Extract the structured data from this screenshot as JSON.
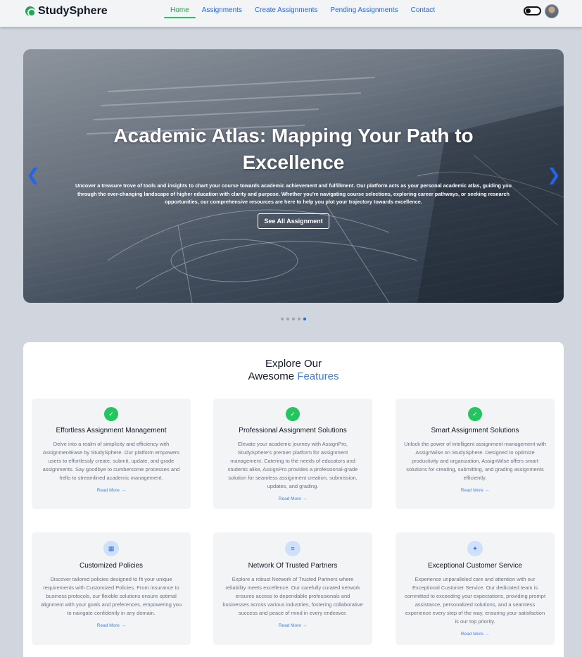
{
  "navbar": {
    "brand": "StudySphere",
    "links": [
      "Home",
      "Assignments",
      "Create Assignments",
      "Pending Assignments",
      "Contact"
    ],
    "active_index": 0
  },
  "hero": {
    "title": "Academic Atlas: Mapping Your Path to Excellence",
    "text": "Uncover a treasure trove of tools and insights to chart your course towards academic achievement and fulfillment. Our platform acts as your personal academic atlas, guiding you through the ever-changing landscape of higher education with clarity and purpose. Whether you're navigating course selections, exploring career pathways, or seeking research opportunities, our comprehensive resources are here to help you plot your trajectory towards excellence.",
    "button": "See All Assignment",
    "slide_count": 5,
    "active_slide": 5
  },
  "features": {
    "heading_line1": "Explore Our",
    "heading_line2": "Awesome",
    "heading_accent": "Features",
    "read_more": "Read More",
    "cards": [
      {
        "icon": "check-badge-icon",
        "title": "Effortless Assignment Management",
        "desc": "Delve into a realm of simplicity and efficiency with AssignmentEase by StudySphere. Our platform empowers users to effortlessly create, submit, update, and grade assignments. Say goodbye to cumbersome processes and hello to streamlined academic management."
      },
      {
        "icon": "check-badge-icon",
        "title": "Professional Assignment Solutions",
        "desc": "Elevate your academic journey with AssignPro, StudySphere's premier platform for assignment management. Catering to the needs of educators and students alike, AssignPro provides a professional-grade solution for seamless assignment creation, submission, updates, and grading."
      },
      {
        "icon": "check-badge-icon",
        "title": "Smart Assignment Solutions",
        "desc": "Unlock the power of intelligent assignment management with AssignWise on StudySphere. Designed to optimize productivity and organization, AssignWise offers smart solutions for creating, submitting, and grading assignments efficiently."
      },
      {
        "icon": "clipboard-icon",
        "title": "Customized Policies",
        "desc": "Discover tailored policies designed to fit your unique requirements with Customized Policies. From insurance to business protocols, our flexible solutions ensure optimal alignment with your goals and preferences, empowering you to navigate confidently in any domain."
      },
      {
        "icon": "sliders-icon",
        "title": "Network Of Trusted Partners",
        "desc": "Explore a robust Network of Trusted Partners where reliability meets excellence. Our carefully curated network ensures access to dependable professionals and businesses across various industries, fostering collaborative success and peace of mind in every endeavor."
      },
      {
        "icon": "sparkle-icon",
        "title": "Exceptional Customer Service",
        "desc": "Experience unparalleled care and attention with our Exceptional Customer Service. Our dedicated team is committed to exceeding your expectations, providing prompt assistance, personalized solutions, and a seamless experience every step of the way, ensuring your satisfaction is our top priority."
      }
    ]
  },
  "colors": {
    "accent_blue": "#2563eb",
    "active_green": "#16a34a",
    "page_bg": "#d1d5de"
  }
}
